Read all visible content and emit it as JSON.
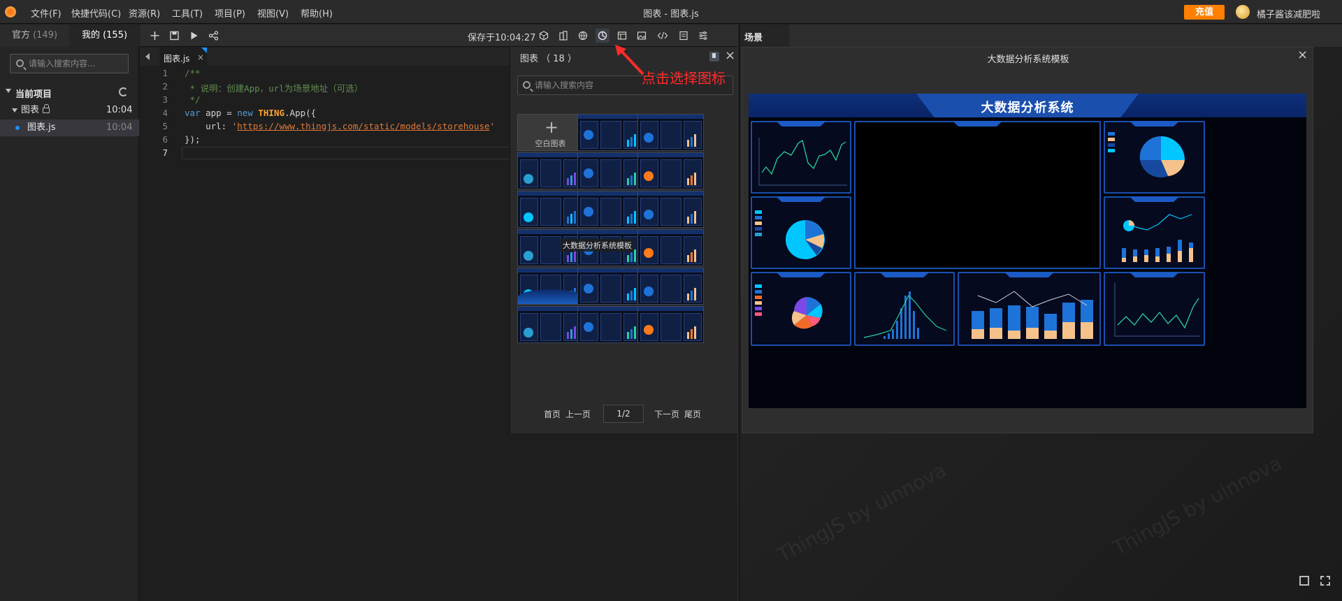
{
  "menubar": {
    "items": [
      "文件(F)",
      "快捷代码(C)",
      "资源(R)",
      "工具(T)",
      "项目(P)",
      "视图(V)",
      "帮助(H)"
    ],
    "window_title": "图表 - 图表.js",
    "recharge_label": "充值",
    "user_name": "橘子酱该减肥啦"
  },
  "sidebar": {
    "tabs": [
      {
        "label": "官方",
        "count": "(149)"
      },
      {
        "label": "我的",
        "count": "(155)"
      }
    ],
    "search_placeholder": "请输入搜索内容...",
    "project_header": "当前项目",
    "tree": [
      {
        "label": "图表",
        "time": "10:04",
        "locked": true
      },
      {
        "label": "图表.js",
        "time": "10:04"
      }
    ]
  },
  "toolbar": {
    "save_status": "保存于10:04:27"
  },
  "editor": {
    "tab_label": "图表.js",
    "tab_close": "×",
    "line_numbers": [
      "1",
      "2",
      "3",
      "4",
      "5",
      "6",
      "7"
    ],
    "code": {
      "l1": "/**",
      "l2": " * 说明：创建App，url为场景地址（可选）",
      "l3": " */",
      "l4_kw": "var",
      "l4_a": " app = ",
      "l4_new": "new",
      "l4_cls": "THING",
      "l4_b": ".App({",
      "l5_a": "    url: ",
      "l5_q": "'",
      "l5_url": "https://www.thingjs.com/static/models/storehouse",
      "l5_q2": "'",
      "l6": "});"
    }
  },
  "chart_panel": {
    "title": "图表 （ 18 ）",
    "close": "×",
    "search_placeholder": "请输入搜索内容",
    "blank_plus": "+",
    "blank_label": "空白图表",
    "hover_tooltip": "大数据分析系统模板",
    "pager": {
      "first": "首页",
      "prev": "上一页",
      "page": "1/2",
      "next": "下一页",
      "last": "尾页"
    }
  },
  "annotation": {
    "text": "点击选择图标",
    "color": "#ff2a2a"
  },
  "scene": {
    "tab_label": "场景",
    "watermark": "ThingJS by uinnova"
  },
  "preview": {
    "title": "大数据分析系统模板",
    "close": "×",
    "dashboard_title": "大数据分析系统"
  },
  "colors": {
    "accent": "#ff7f00",
    "dash_blue": "#1a4fae",
    "highlight": "#1e90ff"
  }
}
